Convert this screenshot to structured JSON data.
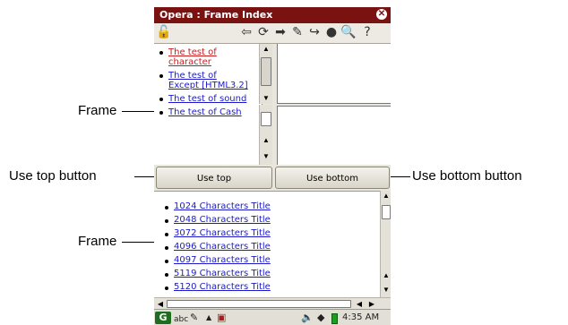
{
  "callouts": {
    "frame_top": "Frame",
    "use_top_button": "Use top button",
    "use_bottom_button": "Use bottom button",
    "frame_bottom": "Frame"
  },
  "window": {
    "title": "Opera : Frame Index"
  },
  "toolbar": {
    "icons": [
      "lock-icon",
      "back-icon",
      "reload-icon",
      "forward-icon",
      "settings-wrench-icon",
      "bookmark-icon",
      "globe-icon",
      "zoom-icon",
      "help-icon"
    ]
  },
  "frame_top_left": {
    "links": [
      {
        "text": "The test of character",
        "visited": true
      },
      {
        "text": "The test of Except [HTML3.2]",
        "visited": false
      },
      {
        "text": "The test of sound",
        "visited": false
      },
      {
        "text": "The test of Cash",
        "visited": false
      }
    ]
  },
  "buttons": {
    "use_top": "Use top",
    "use_bottom": "Use bottom"
  },
  "frame_bottom": {
    "links": [
      "1024 Characters Title",
      "2048 Characters Title",
      "3072 Characters Title",
      "4096 Characters Title",
      "4097 Characters Title",
      "5119 Characters Title",
      "5120 Characters Title"
    ]
  },
  "taskbar": {
    "input_mode": "abc",
    "time": "4:35 AM",
    "icons": [
      "start-icon",
      "pen-icon",
      "up-arrow-icon",
      "keyboard-icon",
      "speaker-icon",
      "network-icon",
      "battery-icon"
    ]
  },
  "colors": {
    "title_bar": "#7a1212",
    "link": "#1a1acc",
    "visited_link": "#cc1a1a",
    "chrome": "#e9e6dd"
  }
}
